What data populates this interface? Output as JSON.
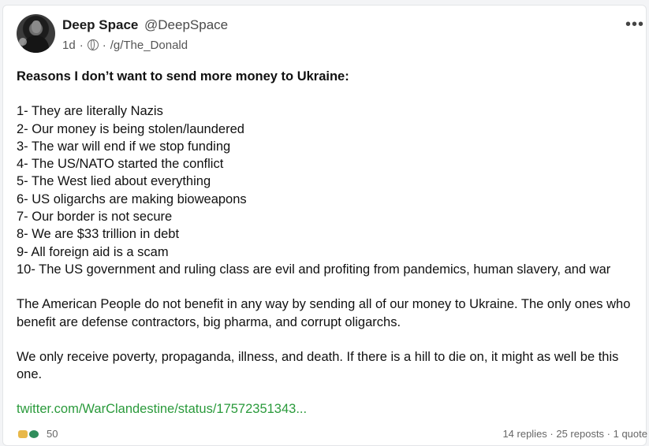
{
  "post": {
    "author_name": "Deep Space",
    "author_handle": "@DeepSpace",
    "time": "1d",
    "separator": "·",
    "group": "/g/The_Donald",
    "more_label": "•••",
    "title": "Reasons I don’t want to send more money to Ukraine:",
    "reasons": [
      "1- They are literally Nazis",
      "2- Our money is being stolen/laundered",
      "3- The war will end if we stop funding",
      "4- The US/NATO started the conflict",
      "5- The West lied about everything",
      "6- US oligarchs are making bioweapons",
      "7- Our border is not secure",
      "8- We are $33 trillion in debt",
      "9- All foreign aid is a scam",
      "10- The US government and ruling class are evil and profiting from pandemics, human slavery, and war"
    ],
    "paragraph1": "The American People do not benefit in any way by sending all of our money to Ukraine. The only ones who benefit are defense contractors, big pharma, and corrupt oligarchs.",
    "paragraph2": "We only receive poverty, propaganda, illness, and death. If there is a hill to die on, it might as well be this one.",
    "link": "twitter.com/WarClandestine/status/17572351343..."
  },
  "footer": {
    "reaction_count": "50",
    "stats": "14 replies · 25 reposts · 1 quote"
  },
  "colors": {
    "link": "#2a9a3b",
    "background": "#f3f4f6",
    "card": "#ffffff"
  }
}
